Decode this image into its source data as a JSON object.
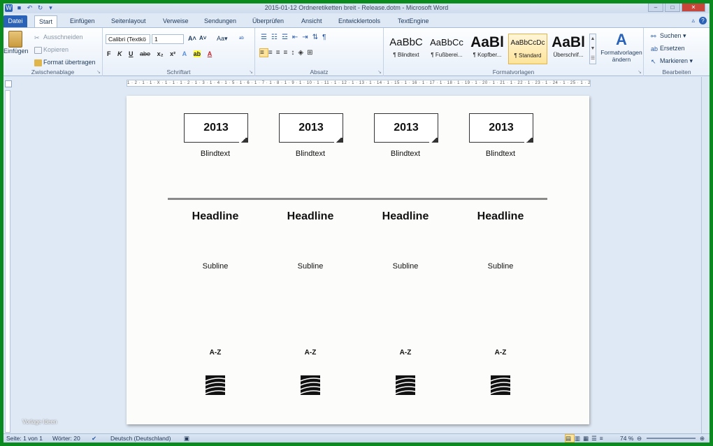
{
  "window": {
    "title": "2015-01-12 Ordneretiketten breit - Release.dotm - Microsoft Word",
    "buttons": {
      "minimize": "–",
      "maximize": "□",
      "close": "✕"
    }
  },
  "tabs": {
    "file": "Datei",
    "items": [
      "Start",
      "Einfügen",
      "Seitenlayout",
      "Verweise",
      "Sendungen",
      "Überprüfen",
      "Ansicht",
      "Entwicklertools",
      "TextEngine"
    ],
    "active": "Start"
  },
  "ribbon": {
    "clipboard": {
      "label": "Zwischenablage",
      "paste": "Einfügen",
      "cut": "Ausschneiden",
      "copy": "Kopieren",
      "format_painter": "Format übertragen"
    },
    "font": {
      "label": "Schriftart",
      "font_name": "Calibri (Textkö",
      "font_size": "1",
      "bold": "F",
      "italic": "K",
      "underline": "U",
      "strike": "abe",
      "subscript": "x₂",
      "superscript": "x²",
      "grow": "A˄",
      "shrink": "A˅",
      "case": "Aa▾"
    },
    "paragraph": {
      "label": "Absatz"
    },
    "styles": {
      "label": "Formatvorlagen",
      "items": [
        {
          "preview": "AaBbC",
          "name": "¶ Blindtext"
        },
        {
          "preview": "AaBbCc",
          "name": "¶ Fußberei..."
        },
        {
          "preview": "AaBl",
          "name": "¶ Kopfber..."
        },
        {
          "preview": "AaBbCcDc",
          "name": "¶ Standard"
        },
        {
          "preview": "AaBl",
          "name": "Überschrif..."
        }
      ],
      "change_styles": "Formatvorlagen ändern"
    },
    "editing": {
      "label": "Bearbeiten",
      "find": "Suchen",
      "replace": "Ersetzen",
      "select": "Markieren"
    }
  },
  "ruler_text": "1 · 2 · 1 · 1 · X · 1 · 1 · 1 · 2 · 1 · 3 · 1 · 4 · 1 · 5 · 1 · 6 · 1 · 7 · 1 · 8 · 1 · 9 · 1 · 10 · 1 · 11 · 1 · 12 · 1 · 13 · 1 · 14 · 1 · 15 · 1 · 16 · 1 · 17 · 1 · 18 · 1 · 19 · 1 · 20 · 1 · 21 · 1 · 22 · 1 · 23 · 1 · 24 · 1 · 25 · 1 · 26 · 1 · 27",
  "document": {
    "columns": [
      {
        "year": "2013",
        "blindtext": "Blindtext",
        "headline": "Headline",
        "subline": "Subline",
        "az": "A-Z"
      },
      {
        "year": "2013",
        "blindtext": "Blindtext",
        "headline": "Headline",
        "subline": "Subline",
        "az": "A-Z"
      },
      {
        "year": "2013",
        "blindtext": "Blindtext",
        "headline": "Headline",
        "subline": "Subline",
        "az": "A-Z"
      },
      {
        "year": "2013",
        "blindtext": "Blindtext",
        "headline": "Headline",
        "subline": "Subline",
        "az": "A-Z"
      }
    ]
  },
  "watermark": "Vorlage Ideen",
  "statusbar": {
    "page": "Seite: 1 von 1",
    "words": "Wörter: 20",
    "language": "Deutsch (Deutschland)",
    "zoom": "74 %"
  },
  "colors": {
    "frame_border": "#0b8a1f",
    "file_tab": "#2a62b8",
    "selected_style": "#fde49a"
  }
}
